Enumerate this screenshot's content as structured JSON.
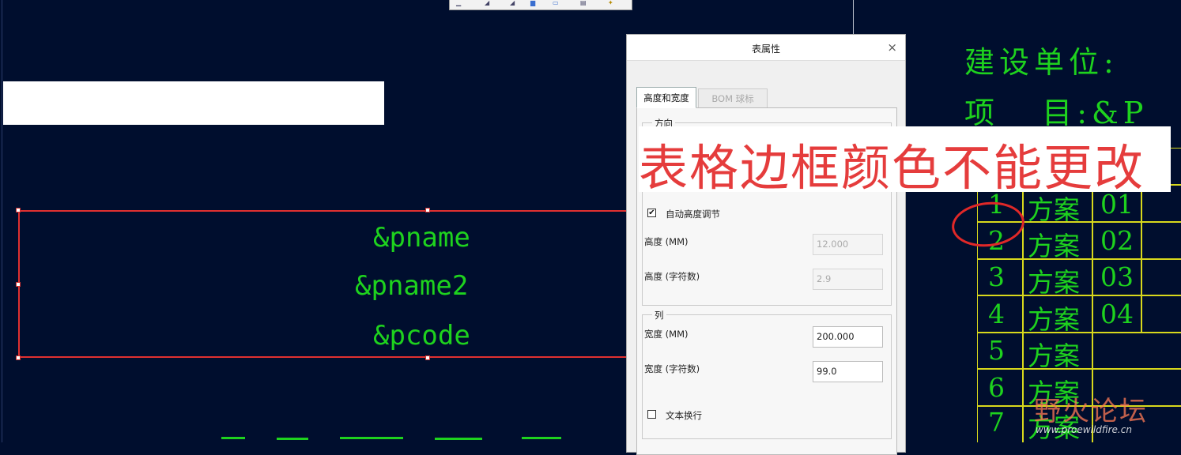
{
  "toolbar": {
    "icons": [
      "draw-icon",
      "dropdown-icon",
      "select-icon",
      "image-icon",
      "note-icon",
      "table-icon",
      "symbol-icon"
    ]
  },
  "canvas": {
    "selected_text": [
      "&pname",
      "&pname2",
      "&pcode"
    ],
    "right_title_1": "建设单位:",
    "right_title_2": "项   目:&P",
    "table_rows": [
      {
        "num": "1",
        "name": "方案",
        "code": "01"
      },
      {
        "num": "2",
        "name": "方案",
        "code": "02"
      },
      {
        "num": "3",
        "name": "方案",
        "code": "03"
      },
      {
        "num": "4",
        "name": "方案",
        "code": "04"
      },
      {
        "num": "5",
        "name": "方案",
        "code": ""
      },
      {
        "num": "6",
        "name": "方案",
        "code": ""
      },
      {
        "num": "7",
        "name": "方案",
        "code": ""
      }
    ],
    "colors": {
      "background": "#000e2e",
      "cad_text": "#1ed21e",
      "table_lines": "#d8d81c",
      "selection": "#e03030"
    }
  },
  "dialog": {
    "title": "表属性",
    "close": "×",
    "tabs": [
      "高度和宽度",
      "BOM 球标"
    ],
    "direction_group": "方向",
    "auto_height_label": "自动高度调节",
    "auto_height_checked": true,
    "height_mm_label": "高度 (MM)",
    "height_mm_value": "12.000",
    "height_chars_label": "高度 (字符数)",
    "height_chars_value": "2.9",
    "column_group": "列",
    "width_mm_label": "宽度 (MM)",
    "width_mm_value": "200.000",
    "width_chars_label": "宽度 (字符数)",
    "width_chars_value": "99.0",
    "wrap_label": "文本换行",
    "wrap_checked": false
  },
  "annotation": {
    "text": "表格边框颜色不能更改",
    "color": "#e53c3c"
  },
  "watermark": {
    "text": "野火论坛",
    "url": "www.proewildfire.cn"
  }
}
